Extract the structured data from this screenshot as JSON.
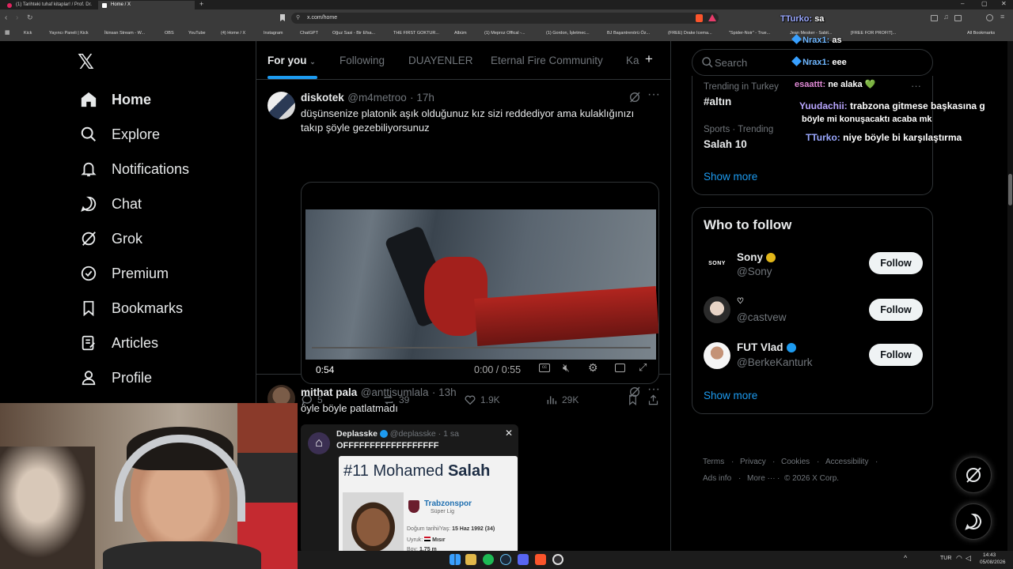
{
  "browser": {
    "tabs": [
      {
        "label": "(1) Tarihteki tuhaf kitaplar! / Prof. Dr.",
        "fav": "#e0245e",
        "active": false
      },
      {
        "label": "Home / X",
        "fav": "#ffffff",
        "active": true
      }
    ],
    "url": "x.com/home",
    "bookmarks": [
      "Kick",
      "Yayıncı Paneli | Kick",
      "İkinsan Stream - W...",
      "OBS",
      "YouTube",
      "(4) Home / X",
      "Instagram",
      "ChatGPT",
      "Oğuz Sasi - Bir Efsa...",
      "THE FIRST GOKTUR...",
      "Albüm",
      "(1) Meproz Offical -...",
      "(1) Gordon, İşletmec...",
      "BJ Başantrenörü Öz...",
      "(FREE) Drake Icema...",
      "\"Spider-Noir\" - True...",
      "Jean Mesker - Sabit...",
      "[FREE FOR PROFIT]...",
      "All Bookmarks"
    ]
  },
  "nav": {
    "items": [
      {
        "label": "Home",
        "icon": "home-icon",
        "active": true
      },
      {
        "label": "Explore",
        "icon": "search-icon",
        "active": false
      },
      {
        "label": "Notifications",
        "icon": "bell-icon",
        "active": false
      },
      {
        "label": "Chat",
        "icon": "chat-icon",
        "active": false
      },
      {
        "label": "Grok",
        "icon": "grok-icon",
        "active": false
      },
      {
        "label": "Premium",
        "icon": "verified-icon",
        "active": false
      },
      {
        "label": "Bookmarks",
        "icon": "bookmark-icon",
        "active": false
      },
      {
        "label": "Articles",
        "icon": "article-icon",
        "active": false
      },
      {
        "label": "Profile",
        "icon": "user-icon",
        "active": false
      }
    ]
  },
  "feed": {
    "tabs": [
      "For you",
      "Following",
      "DUAYENLER",
      "Eternal Fire Community",
      "Ka"
    ],
    "post1": {
      "name": "diskotek",
      "handle": "@m4metroo",
      "time": "· 17h",
      "text": "düşünsenize platonik aşık olduğunuz kız sizi reddediyor ama kulaklığınızı takıp şöyle gezebiliyorsunuz",
      "video_remaining": "0:54",
      "video_time": "0:00 / 0:55",
      "video_progress": 0,
      "replies": "5",
      "reposts": "39",
      "likes": "1.9K",
      "views": "29K"
    },
    "post2": {
      "name": "mithat pala",
      "handle": "@anttisumlala",
      "time": "· 13h",
      "text": "öyle böyle patlatmadı",
      "quote": {
        "name": "Deplasske",
        "handle": "@deplasske",
        "time": "· 1 sa",
        "text": "OFFFFFFFFFFFFFFFFFF",
        "card": {
          "number": "#11",
          "first": "Mohamed",
          "last": "Salah",
          "club": "Trabzonspor",
          "league": "Süper Lig",
          "dob_label": "Doğum tarihi/Yaş:",
          "dob": "15 Haz 1992 (34)",
          "nation_label": "Uyruk:",
          "nation": "Mısır",
          "height_label": "Boy:",
          "height": "1,75 m"
        }
      }
    }
  },
  "right": {
    "search_placeholder": "Search",
    "trends": [
      {
        "category": "Trending in Turkey",
        "name": "#altın"
      },
      {
        "category": "Sports · Trending",
        "name": "Salah 10"
      }
    ],
    "trends_show_more": "Show more",
    "who_title": "Who to follow",
    "who": [
      {
        "name": "Sony",
        "handle": "@Sony",
        "verified": "gold",
        "follow": "Follow"
      },
      {
        "name": "♡",
        "handle": "@castvew",
        "verified": "none",
        "follow": "Follow"
      },
      {
        "name": "FUT Vlad",
        "handle": "@BerkeKanturk",
        "verified": "blue",
        "follow": "Follow"
      }
    ],
    "who_show_more": "Show more",
    "footer": [
      "Terms",
      "Privacy",
      "Cookies",
      "Accessibility",
      "Ads info",
      "More ···",
      "© 2026 X Corp."
    ]
  },
  "chat_overlay": [
    {
      "user": "TTurko:",
      "msg": "sa",
      "color": "#9aa8ff"
    },
    {
      "user": "Nrax1:",
      "msg": "as",
      "color": "#6fb7ff"
    },
    {
      "user": "Nrax1:",
      "msg": "eee",
      "color": "#6fb7ff"
    },
    {
      "user": "esaattt:",
      "msg": "ne alaka 💚",
      "color": "#e08ad6"
    },
    {
      "user": "Yuudachii:",
      "msg": "trabzona gitmese başkasına g",
      "color": "#b9a6ff"
    },
    {
      "user": "",
      "msg": "böyle mi konuşacaktı acaba mk",
      "color": "#fff"
    },
    {
      "user": "TTurko:",
      "msg": "niye böyle bi karşılaştırma",
      "color": "#9aa8ff"
    }
  ],
  "system": {
    "lang": "TUR",
    "time": "14:43",
    "date": "05/08/2026"
  },
  "colors": {
    "accent": "#1d9bf0",
    "background": "#000000",
    "border": "#2f3336",
    "muted": "#71767b"
  }
}
